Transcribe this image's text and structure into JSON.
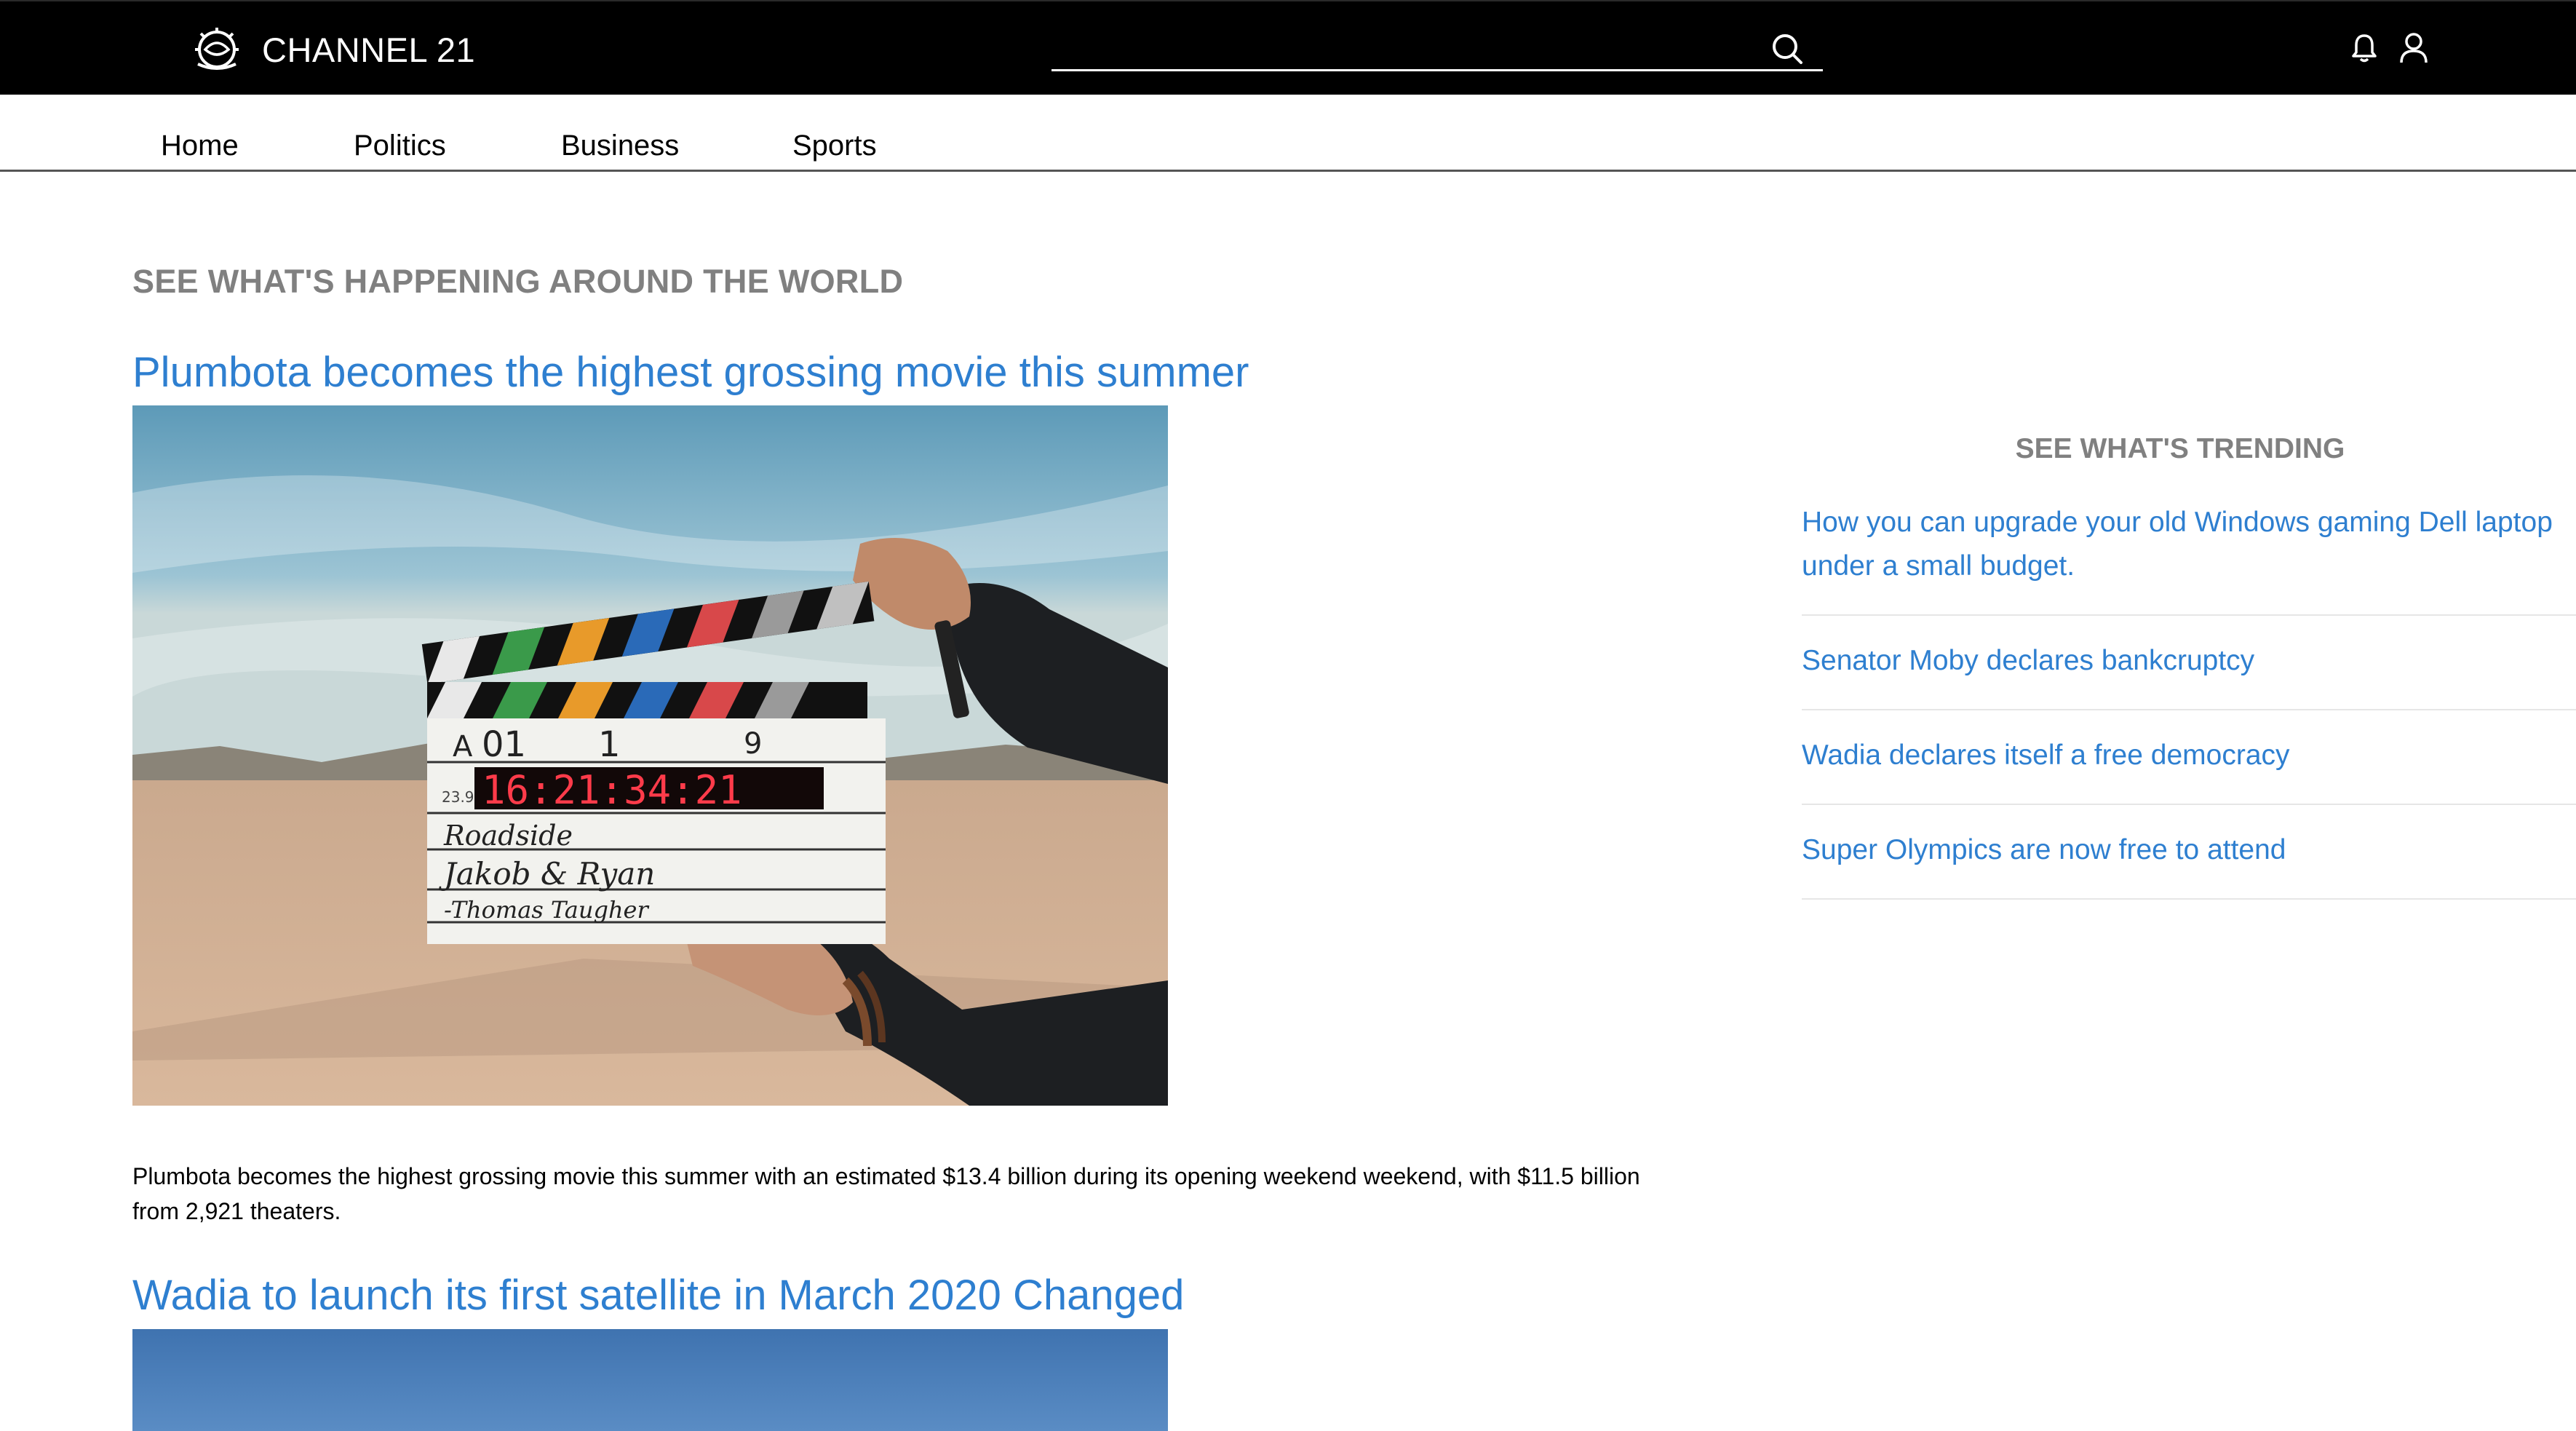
{
  "header": {
    "brand_name": "CHANNEL 21",
    "logo_icon": "astronaut-helmet-icon",
    "search": {
      "placeholder": "",
      "value": "",
      "icon": "search-icon"
    },
    "icons": [
      "bell-icon",
      "user-icon"
    ]
  },
  "nav": {
    "items": [
      {
        "label": "Home"
      },
      {
        "label": "Politics"
      },
      {
        "label": "Business"
      },
      {
        "label": "Sports"
      }
    ]
  },
  "main": {
    "heading": "SEE WHAT'S HAPPENING AROUND THE WORLD",
    "articles": [
      {
        "title": "Plumbota becomes the highest grossing movie this summer",
        "summary": "Plumbota becomes the highest grossing movie this summer with an estimated $13.4 billion during its opening weekend weekend, with $11.5 billion from 2,921 theaters.",
        "image": {
          "clapper": {
            "roll": "A",
            "scene": "01",
            "take_a": "1",
            "take_b": "9",
            "fps": "23.98",
            "timecode": "16:21:34:21",
            "line1": "Roadside",
            "line2": "Jakob & Ryan",
            "line3": "-Thomas Taugher"
          }
        }
      },
      {
        "title": "Wadia to launch its first satellite in March 2020 Changed"
      }
    ]
  },
  "sidebar": {
    "heading": "SEE WHAT'S TRENDING",
    "items": [
      {
        "label": "How you can upgrade your old Windows gaming Dell laptop under a small budget."
      },
      {
        "label": "Senator Moby declares bankcruptcy"
      },
      {
        "label": "Wadia declares itself a free democracy"
      },
      {
        "label": "Super Olympics are now free to attend"
      }
    ]
  },
  "colors": {
    "topbar_bg": "#000000",
    "link": "#2e7fd0",
    "heading_gray": "#808080",
    "nav_text": "#000000"
  }
}
